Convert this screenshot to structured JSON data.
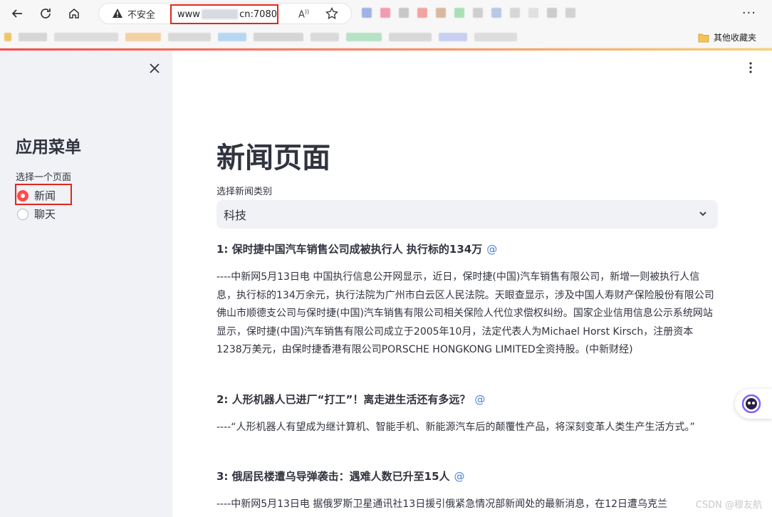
{
  "browser": {
    "security_label": "不安全",
    "url_prefix": "www",
    "url_suffix": "cn:7080",
    "read_aloud": "A⁾",
    "bookmarks_folder": "其他收藏夹"
  },
  "sidebar": {
    "title": "应用菜单",
    "radio_label": "选择一个页面",
    "options": [
      "新闻",
      "聊天"
    ],
    "selected": "新闻"
  },
  "main": {
    "title": "新闻页面",
    "select_label": "选择新闻类别",
    "select_value": "科技",
    "articles": [
      {
        "title": "1: 保时捷中国汽车销售公司成被执行人 执行标的134万",
        "link": "@",
        "body": "----中新网5月13日电 中国执行信息公开网显示，近日，保时捷(中国)汽车销售有限公司，新增一则被执行人信息，执行标的134万余元，执行法院为广州市白云区人民法院。天眼查显示，涉及中国人寿财产保险股份有限公司佛山市顺德支公司与保时捷(中国)汽车销售有限公司相关保险人代位求偿权纠纷。国家企业信用信息公示系统网站显示，保时捷(中国)汽车销售有限公司成立于2005年10月，法定代表人为Michael Horst Kirsch，注册资本1238万美元，由保时捷香港有限公司PORSCHE HONGKONG LIMITED全资持股。(中新财经)"
      },
      {
        "title": "2: 人形机器人已进厂“打工”！离走进生活还有多远？",
        "link": "@",
        "body": "----“人形机器人有望成为继计算机、智能手机、新能源汽车后的颠覆性产品，将深刻变革人类生产生活方式。”"
      },
      {
        "title": "3: 俄居民楼遭乌导弹袭击：遇难人数已升至15人",
        "link": "@",
        "body": "----中新网5月13日电 据俄罗斯卫星通讯社13日援引俄紧急情况部新闻处的最新消息，在12日遭乌克兰"
      }
    ]
  },
  "watermark": "CSDN @穆友航",
  "colors": {
    "accent": "#ff4b4b",
    "sidebar_bg": "#f0f2f6",
    "highlight_box": "#e0281c",
    "link": "#4a7fd6"
  }
}
